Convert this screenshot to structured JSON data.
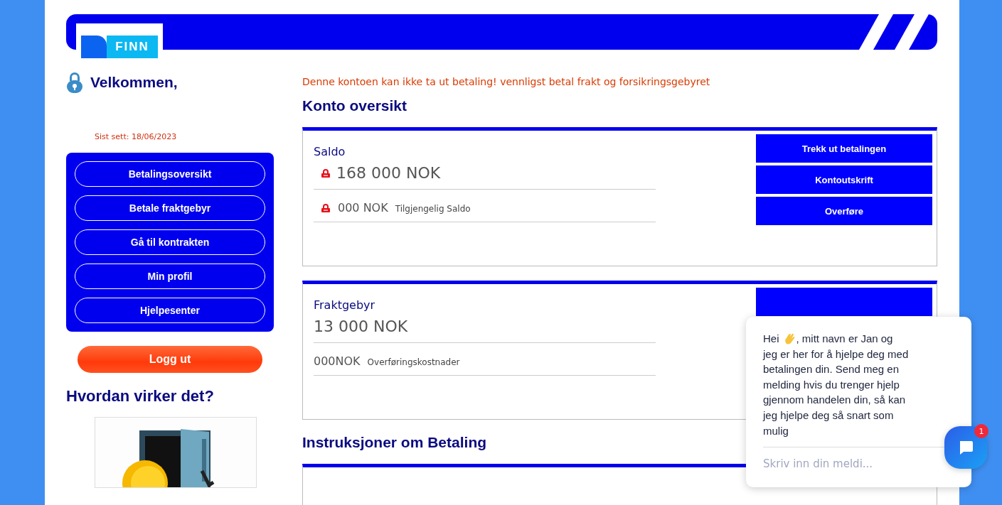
{
  "logo": {
    "text": "FINN"
  },
  "sidebar": {
    "welcome": "Velkommen,",
    "last_seen": "Sist sett: 18/06/2023",
    "menu": [
      {
        "label": "Betalingsoversikt"
      },
      {
        "label": "Betale fraktgebyr"
      },
      {
        "label": "Gå til kontrakten"
      },
      {
        "label": "Min profil"
      },
      {
        "label": "Hjelpesenter"
      }
    ],
    "logout": "Logg ut",
    "how_heading": "Hvordan virker det?"
  },
  "main": {
    "alert": "Denne kontoen kan ikke ta ut betaling! vennligst betal frakt og forsikringsgebyret",
    "heading": "Konto oversikt",
    "cards": [
      {
        "title": "Saldo",
        "amount": "168 000 NOK",
        "locked": true,
        "sub_amount": "000 NOK",
        "sub_label": "Tilgjengelig Saldo",
        "buttons": [
          "Trekk ut betalingen",
          "Kontoutskrift",
          "Overføre"
        ]
      },
      {
        "title": "Fraktgebyr",
        "amount": "13 000 NOK",
        "locked": false,
        "sub_amount": "000NOK",
        "sub_label": "Overføringskostnader",
        "covered_button": true
      }
    ],
    "instructions_heading": "Instruksjoner om Betaling"
  },
  "chat": {
    "greeting": "Hei",
    "message_start": ", mitt navn er Jan og",
    "message": "jeg er her for å hjelpe deg med betalingen din. Send meg en melding hvis du trenger hjelp gjennom handelen din, så kan jeg hjelpe deg så snart som mulig",
    "placeholder": "Skriv inn din meldi...",
    "badge": "1"
  }
}
